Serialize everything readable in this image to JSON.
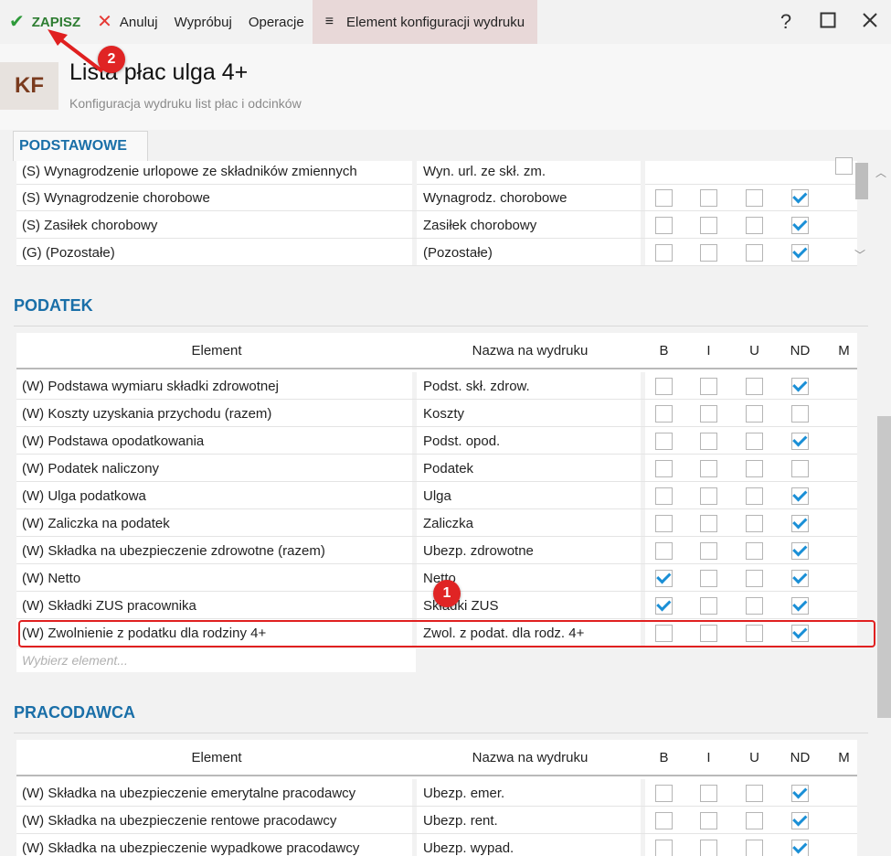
{
  "toolbar": {
    "save_label": "ZAPISZ",
    "cancel_label": "Anuluj",
    "try_label": "Wypróbuj",
    "operations_label": "Operacje",
    "menu_label": "Element konfiguracji wydruku",
    "help_label": "?",
    "icons": {
      "save": "check-icon",
      "cancel": "close-x-icon",
      "menu": "hamburger-icon"
    }
  },
  "header": {
    "badge": "KF",
    "title": "Lista płac ulga 4+",
    "subtitle": "Konfiguracja wydruku list płac i odcinków"
  },
  "tabs": [
    "PODSTAWOWE"
  ],
  "columns": {
    "element": "Element",
    "name": "Nazwa na wydruku",
    "b": "B",
    "i": "I",
    "u": "U",
    "nd": "ND",
    "m": "M"
  },
  "top_grid": {
    "rows": [
      {
        "element": "(S) Wynagrodzenie urlopowe ze składników zmiennych",
        "name": "Wyn. url. ze skł. zm.",
        "partial": true
      },
      {
        "element": "(S) Wynagrodzenie chorobowe",
        "name": "Wynagrodz. chorobowe",
        "b": false,
        "i": false,
        "u": false,
        "nd": true
      },
      {
        "element": "(S) Zasiłek chorobowy",
        "name": "Zasiłek chorobowy",
        "b": false,
        "i": false,
        "u": false,
        "nd": true
      },
      {
        "element": "(G) (Pozostałe)",
        "name": "(Pozostałe)",
        "b": false,
        "i": false,
        "u": false,
        "nd": true
      }
    ]
  },
  "podatek": {
    "title": "PODATEK",
    "rows": [
      {
        "element": "(W) Podstawa wymiaru składki zdrowotnej",
        "name": "Podst. skł. zdrow.",
        "b": false,
        "i": false,
        "u": false,
        "nd": true
      },
      {
        "element": "(W) Koszty uzyskania przychodu (razem)",
        "name": "Koszty",
        "b": false,
        "i": false,
        "u": false,
        "nd": false
      },
      {
        "element": "(W) Podstawa opodatkowania",
        "name": "Podst. opod.",
        "b": false,
        "i": false,
        "u": false,
        "nd": true
      },
      {
        "element": "(W) Podatek naliczony",
        "name": "Podatek",
        "b": false,
        "i": false,
        "u": false,
        "nd": false
      },
      {
        "element": "(W) Ulga podatkowa",
        "name": "Ulga",
        "b": false,
        "i": false,
        "u": false,
        "nd": true
      },
      {
        "element": "(W) Zaliczka na podatek",
        "name": "Zaliczka",
        "b": false,
        "i": false,
        "u": false,
        "nd": true
      },
      {
        "element": "(W) Składka na ubezpieczenie zdrowotne (razem)",
        "name": "Ubezp. zdrowotne",
        "b": false,
        "i": false,
        "u": false,
        "nd": true
      },
      {
        "element": "(W) Netto",
        "name": "Netto",
        "b": true,
        "i": false,
        "u": false,
        "nd": true
      },
      {
        "element": "(W) Składki ZUS pracownika",
        "name": "Składki ZUS",
        "b": true,
        "i": false,
        "u": false,
        "nd": true
      },
      {
        "element": "(W) Zwolnienie z podatku dla rodziny 4+",
        "name": "Zwol. z podat. dla rodz. 4+",
        "b": false,
        "i": false,
        "u": false,
        "nd": true
      }
    ],
    "picker_placeholder": "Wybierz element..."
  },
  "pracodawca": {
    "title": "PRACODAWCA",
    "rows": [
      {
        "element": "(W) Składka na ubezpieczenie emerytalne pracodawcy",
        "name": "Ubezp. emer.",
        "b": false,
        "i": false,
        "u": false,
        "nd": true
      },
      {
        "element": "(W) Składka na ubezpieczenie rentowe pracodawcy",
        "name": "Ubezp. rent.",
        "b": false,
        "i": false,
        "u": false,
        "nd": true
      },
      {
        "element": "(W) Składka na ubezpieczenie wypadkowe pracodawcy",
        "name": "Ubezp. wypad.",
        "b": false,
        "i": false,
        "u": false,
        "nd": true
      }
    ]
  },
  "annotations": {
    "marker_1": "1",
    "marker_2": "2",
    "highlight_color": "#e02020"
  },
  "colors": {
    "accent": "#1a6fa8",
    "save": "#2e9a3a",
    "cancel": "#e53935",
    "check": "#1a8fd6"
  }
}
